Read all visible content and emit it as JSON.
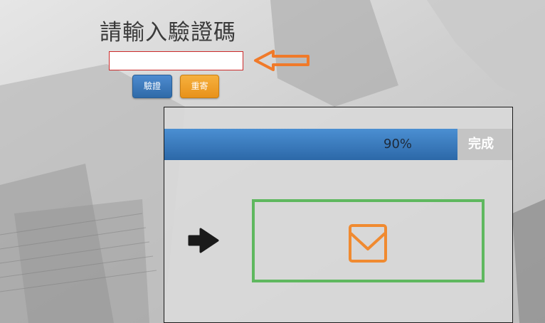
{
  "verification": {
    "title": "請輸入驗證碼",
    "code_value": "",
    "verify_label": "驗證",
    "resend_label": "重寄"
  },
  "progress": {
    "percent": 90,
    "percent_label": "90%",
    "done_label": "完成"
  },
  "icons": {
    "hint_arrow": "left-arrow-outline-icon",
    "go_arrow": "right-arrow-icon",
    "mail": "envelope-icon"
  },
  "colors": {
    "input_border": "#cc2a2a",
    "verify_button": "#337ab7",
    "resend_button": "#f0a030",
    "progress_fill": "#337ab7",
    "highlight_box": "#5fb85f",
    "mail_icon": "#f08a30",
    "hint_arrow": "#f07a2a"
  }
}
